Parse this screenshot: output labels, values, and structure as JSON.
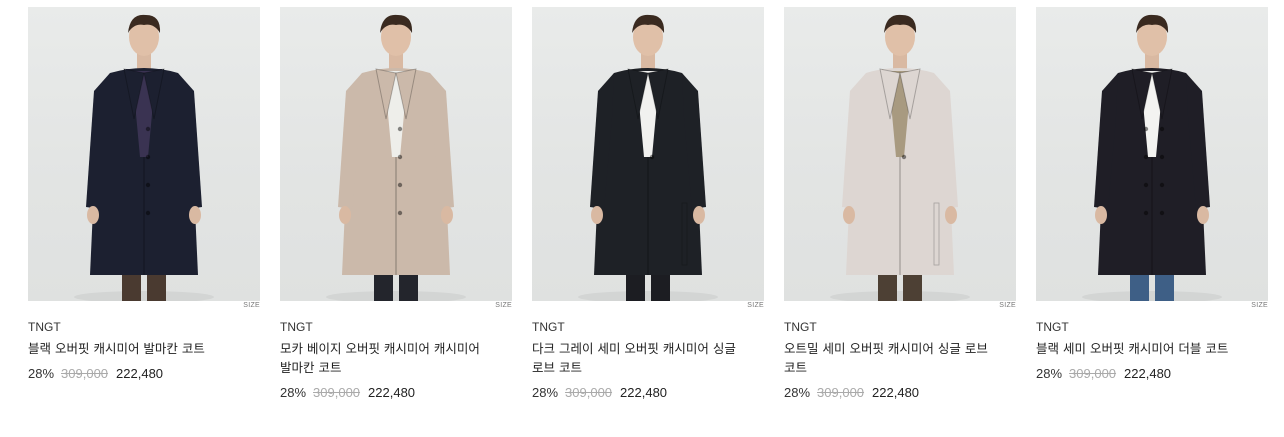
{
  "products": [
    {
      "brand": "TNGT",
      "name": "블랙 오버핏 캐시미어 발마칸 코트",
      "size_label": "SIZE",
      "discount": "28%",
      "original_price": "309,000",
      "sale_price": "222,480",
      "coat_color": "#1c2030",
      "inner_color": "#3a3352",
      "pants_color": "#4a3a30",
      "coat_style": "balmacaan"
    },
    {
      "brand": "TNGT",
      "name": "모카 베이지 오버핏 캐시미어 캐시미어 발마칸 코트",
      "size_label": "SIZE",
      "discount": "28%",
      "original_price": "309,000",
      "sale_price": "222,480",
      "coat_color": "#cbb9aa",
      "inner_color": "#eeeeea",
      "pants_color": "#23252c",
      "coat_style": "balmacaan"
    },
    {
      "brand": "TNGT",
      "name": "다크 그레이 세미 오버핏 캐시미어 싱글 로브 코트",
      "size_label": "SIZE",
      "discount": "28%",
      "original_price": "309,000",
      "sale_price": "222,480",
      "coat_color": "#1e2126",
      "inner_color": "#f1f1ef",
      "pants_color": "#1c1d22",
      "coat_style": "robe"
    },
    {
      "brand": "TNGT",
      "name": "오트밀 세미 오버핏 캐시미어 싱글 로브 코트",
      "size_label": "SIZE",
      "discount": "28%",
      "original_price": "309,000",
      "sale_price": "222,480",
      "coat_color": "#ddd6d2",
      "inner_color": "#a89a80",
      "pants_color": "#4d4034",
      "coat_style": "robe"
    },
    {
      "brand": "TNGT",
      "name": "블랙 세미 오버핏 캐시미어 더블 코트",
      "size_label": "SIZE",
      "discount": "28%",
      "original_price": "309,000",
      "sale_price": "222,480",
      "coat_color": "#1f1e26",
      "inner_color": "#f3f3f1",
      "pants_color": "#3e5f86",
      "coat_style": "double"
    }
  ]
}
